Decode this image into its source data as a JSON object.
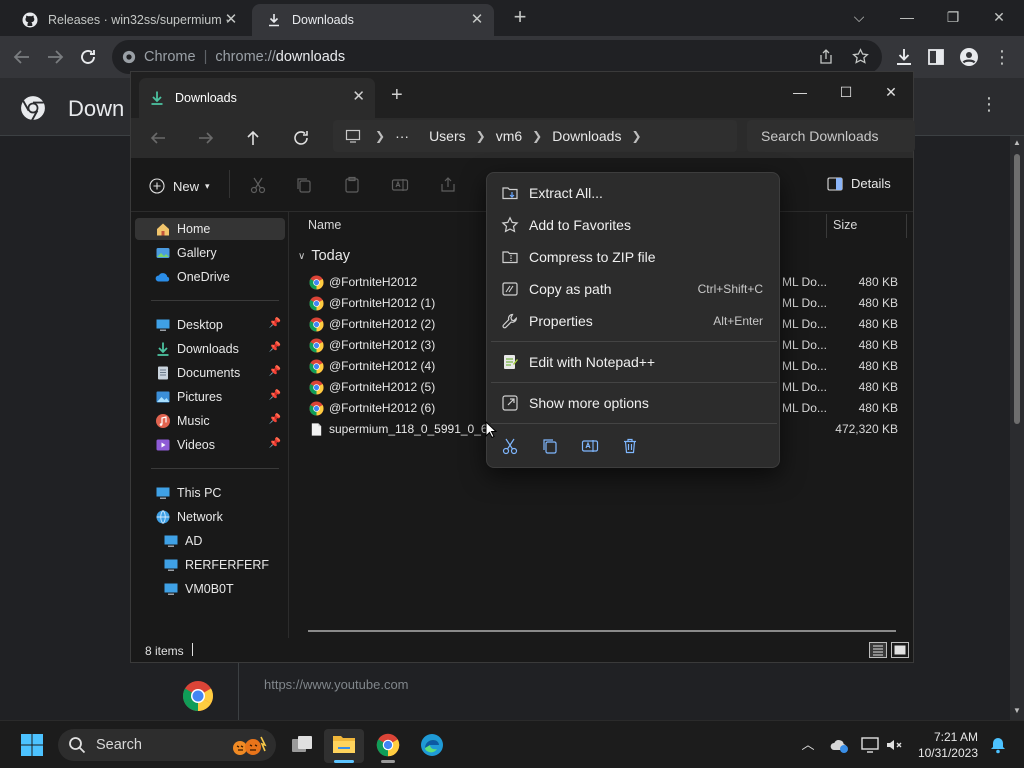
{
  "chrome": {
    "tabs": [
      {
        "title": "Releases · win32ss/supermium ·"
      },
      {
        "title": "Downloads"
      }
    ],
    "omnibox": {
      "site": "Chrome",
      "url_prefix": "chrome://",
      "url_main": "downloads"
    },
    "page": {
      "title": "Down",
      "entry_url": "https://www.youtube.com"
    }
  },
  "explorer": {
    "tab_title": "Downloads",
    "breadcrumbs": [
      "Users",
      "vm6",
      "Downloads"
    ],
    "ellipsis": "···",
    "search_placeholder": "Search Downloads",
    "new_label": "New",
    "details_label": "Details",
    "sidebar": {
      "quick": [
        {
          "label": "Home",
          "icon": "home-icon",
          "selected": true
        },
        {
          "label": "Gallery",
          "icon": "gallery-icon"
        },
        {
          "label": "OneDrive",
          "icon": "onedrive-icon"
        }
      ],
      "pinned": [
        {
          "label": "Desktop",
          "icon": "desktop-icon"
        },
        {
          "label": "Downloads",
          "icon": "download-icon"
        },
        {
          "label": "Documents",
          "icon": "documents-icon"
        },
        {
          "label": "Pictures",
          "icon": "pictures-icon"
        },
        {
          "label": "Music",
          "icon": "music-icon"
        },
        {
          "label": "Videos",
          "icon": "videos-icon"
        }
      ],
      "locations": [
        {
          "label": "This PC",
          "icon": "computer-icon"
        },
        {
          "label": "Network",
          "icon": "network-icon"
        },
        {
          "label": "AD",
          "icon": "computer-icon"
        },
        {
          "label": "RERFERFERF",
          "icon": "computer-icon"
        },
        {
          "label": "VM0B0T",
          "icon": "computer-icon"
        }
      ]
    },
    "columns": {
      "name": "Name",
      "size": "Size"
    },
    "group": "Today",
    "files": [
      {
        "name": "@FortniteH2012",
        "type": "ML Do...",
        "size": "480 KB",
        "icon": "chrome-html-icon"
      },
      {
        "name": "@FortniteH2012 (1)",
        "type": "ML Do...",
        "size": "480 KB",
        "icon": "chrome-html-icon"
      },
      {
        "name": "@FortniteH2012 (2)",
        "type": "ML Do...",
        "size": "480 KB",
        "icon": "chrome-html-icon"
      },
      {
        "name": "@FortniteH2012 (3)",
        "type": "ML Do...",
        "size": "480 KB",
        "icon": "chrome-html-icon"
      },
      {
        "name": "@FortniteH2012 (4)",
        "type": "ML Do...",
        "size": "480 KB",
        "icon": "chrome-html-icon"
      },
      {
        "name": "@FortniteH2012 (5)",
        "type": "ML Do...",
        "size": "480 KB",
        "icon": "chrome-html-icon"
      },
      {
        "name": "@FortniteH2012 (6)",
        "type": "ML Do...",
        "size": "480 KB",
        "icon": "chrome-html-icon"
      },
      {
        "name": "supermium_118_0_5991_0_64_",
        "type": "",
        "size": "472,320 KB",
        "icon": "file-icon"
      }
    ],
    "status": "8 items"
  },
  "context_menu": {
    "items": [
      {
        "label": "Extract All...",
        "shortcut": "",
        "icon": "extract-icon"
      },
      {
        "label": "Add to Favorites",
        "shortcut": "",
        "icon": "star-icon"
      },
      {
        "label": "Compress to ZIP file",
        "shortcut": "",
        "icon": "zip-icon"
      },
      {
        "label": "Copy as path",
        "shortcut": "Ctrl+Shift+C",
        "icon": "copy-path-icon"
      },
      {
        "label": "Properties",
        "shortcut": "Alt+Enter",
        "icon": "wrench-icon"
      },
      {
        "label": "Edit with Notepad++",
        "shortcut": "",
        "icon": "notepadpp-icon"
      },
      {
        "label": "Show more options",
        "shortcut": "",
        "icon": "more-options-icon"
      }
    ]
  },
  "taskbar": {
    "search_label": "Search",
    "time": "7:21 AM",
    "date": "10/31/2023"
  },
  "colors": {
    "accent": "#5cc4ff",
    "chrome_bg": "#202124",
    "explorer_bg": "#191919",
    "menu_bg": "#2c2c2c"
  }
}
